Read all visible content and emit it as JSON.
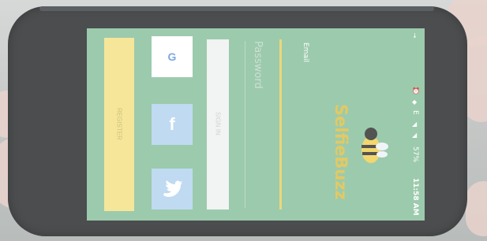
{
  "status_bar": {
    "time": "11:58 AM",
    "battery": "57%",
    "network": "E",
    "icons": [
      "alarm-icon",
      "wifi-icon",
      "signal-icon",
      "signal-icon",
      "battery-icon",
      "download-icon"
    ]
  },
  "app": {
    "logo_text": "SelfieBuzz",
    "email_label": "Email",
    "password_placeholder": "Password",
    "signin_label": "SIGN IN",
    "register_label": "REGISTER",
    "social": {
      "google": "G",
      "facebook": "f",
      "twitter_icon": "twitter-bird-icon"
    }
  },
  "colors": {
    "screen_bg": "#8fc3a2",
    "accent": "#e8d46a",
    "register_bg": "#f4e38b",
    "logo": "#dfc24f"
  }
}
